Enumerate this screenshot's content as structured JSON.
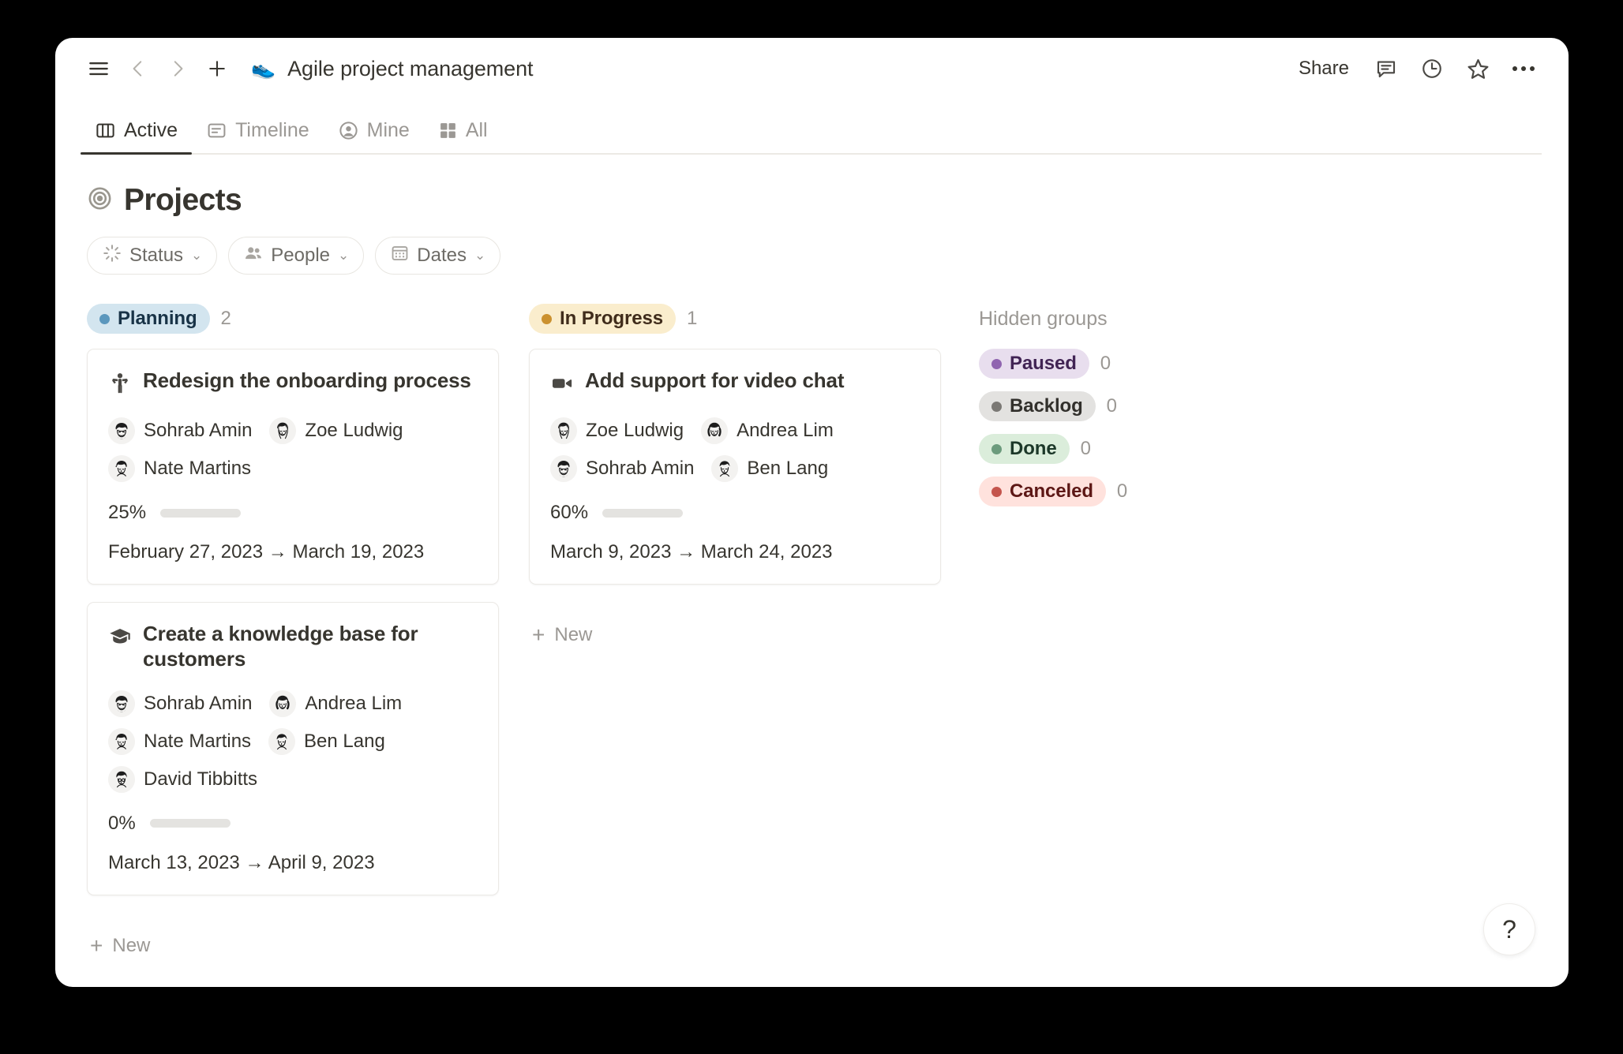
{
  "window": {
    "topbar": {
      "menu_icon": "hamburger-menu-icon",
      "back_icon": "chevron-left-icon",
      "forward_icon": "chevron-right-icon",
      "new_icon": "plus-icon",
      "doc_emoji": "👟",
      "doc_title": "Agile project management",
      "share_label": "Share",
      "comments_icon": "comment-icon",
      "history_icon": "clock-icon",
      "favorite_icon": "star-icon",
      "more_icon": "more-options-icon"
    },
    "tabs": [
      {
        "label": "Active",
        "icon": "board-view-icon",
        "active": true
      },
      {
        "label": "Timeline",
        "icon": "timeline-view-icon",
        "active": false
      },
      {
        "label": "Mine",
        "icon": "person-circle-icon",
        "active": false
      },
      {
        "label": "All",
        "icon": "grid-view-icon",
        "active": false
      }
    ],
    "page": {
      "icon": "target-icon",
      "title": "Projects",
      "filters": [
        {
          "label": "Status",
          "icon": "spinner-icon",
          "caret": "⌄"
        },
        {
          "label": "People",
          "icon": "people-icon",
          "caret": "⌄"
        },
        {
          "label": "Dates",
          "icon": "calendar-icon",
          "caret": "⌄"
        }
      ]
    },
    "board": {
      "groups": [
        {
          "name": "Planning",
          "count": "2",
          "pill_bg": "#d3e5ef",
          "pill_text": "#183347",
          "dot": "#5b97bd",
          "new_label": "New",
          "cards": [
            {
              "emoji": "🧍",
              "title": "Redesign the onboarding process",
              "assignees": [
                "Sohrab Amin",
                "Zoe Ludwig",
                "Nate Martins"
              ],
              "percent_label": "25%",
              "percent_value": 25,
              "date_range": "February 27, 2023 → March 19, 2023"
            },
            {
              "emoji": "🎓",
              "title": "Create a knowledge base for customers",
              "assignees": [
                "Sohrab Amin",
                "Andrea Lim",
                "Nate Martins",
                "Ben Lang",
                "David Tibbitts"
              ],
              "percent_label": "0%",
              "percent_value": 0,
              "date_range": "March 13, 2023 → April 9, 2023"
            }
          ]
        },
        {
          "name": "In Progress",
          "count": "1",
          "pill_bg": "#faedcd",
          "pill_text": "#402c1b",
          "dot": "#cb912f",
          "new_label": "New",
          "cards": [
            {
              "emoji": "📹",
              "title": "Add support for video chat",
              "assignees": [
                "Zoe Ludwig",
                "Andrea Lim",
                "Sohrab Amin",
                "Ben Lang"
              ],
              "percent_label": "60%",
              "percent_value": 60,
              "date_range": "March 9, 2023 → March 24, 2023"
            }
          ]
        }
      ],
      "hidden": {
        "title": "Hidden groups",
        "items": [
          {
            "name": "Paused",
            "count": "0",
            "pill_bg": "#e8deee",
            "pill_text": "#412454",
            "dot": "#9065b0"
          },
          {
            "name": "Backlog",
            "count": "0",
            "pill_bg": "#e3e2e0",
            "pill_text": "#32302c",
            "dot": "#7b7975"
          },
          {
            "name": "Done",
            "count": "0",
            "pill_bg": "#dbeddb",
            "pill_text": "#1c3829",
            "dot": "#6c9b7d"
          },
          {
            "name": "Canceled",
            "count": "0",
            "pill_bg": "#ffe2dd",
            "pill_text": "#5d1715",
            "dot": "#c4554d"
          }
        ]
      }
    },
    "help_label": "?"
  }
}
